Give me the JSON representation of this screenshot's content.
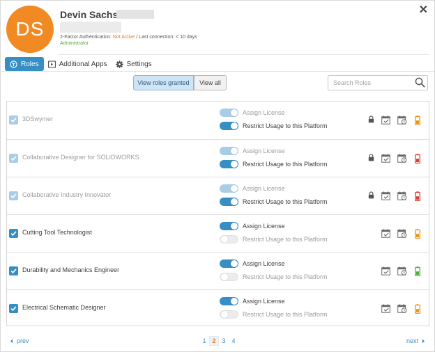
{
  "header": {
    "avatar_initials": "DS",
    "avatar_color": "#f28a24",
    "user_name": "Devin Sachs -",
    "auth_prefix": "2-Factor Authentication: ",
    "auth_status": "Not Active",
    "last_connection": " / Last connection: < 10 days",
    "user_role": "Administrator",
    "close_label": "✕"
  },
  "tabs": [
    {
      "label": "Roles",
      "icon": "roles-icon",
      "active": true
    },
    {
      "label": "Additional Apps",
      "icon": "apps-icon",
      "active": false
    },
    {
      "label": "Settings",
      "icon": "gear-icon",
      "active": false
    }
  ],
  "filters": {
    "view_granted": "View roles granted",
    "view_all": "View all"
  },
  "search": {
    "placeholder": "Search Roles",
    "value": ""
  },
  "toggle_labels": {
    "assign": "Assign License",
    "restrict": "Restrict Usage to this Platform"
  },
  "roles": [
    {
      "name": "3DSwymer",
      "checked": true,
      "locked": true,
      "assign_license": true,
      "restrict_usage": true,
      "license_status": "orange"
    },
    {
      "name": "Collaborative Designer for SOLIDWORKS",
      "checked": true,
      "locked": true,
      "assign_license": true,
      "restrict_usage": true,
      "license_status": "red"
    },
    {
      "name": "Collaborative Industry Innovator",
      "checked": true,
      "locked": true,
      "assign_license": true,
      "restrict_usage": true,
      "license_status": "red"
    },
    {
      "name": "Cutting Tool Technologist",
      "checked": true,
      "locked": false,
      "assign_license": true,
      "restrict_usage": false,
      "license_status": "orange"
    },
    {
      "name": "Durability and Mechanics Engineer",
      "checked": true,
      "locked": false,
      "assign_license": true,
      "restrict_usage": false,
      "license_status": "green"
    },
    {
      "name": "Electrical Schematic Designer",
      "checked": true,
      "locked": false,
      "assign_license": true,
      "restrict_usage": false,
      "license_status": "orange"
    }
  ],
  "pagination": {
    "prev": "prev",
    "next": "next",
    "pages": [
      "1",
      "2",
      "3",
      "4"
    ],
    "current": "2"
  },
  "colors": {
    "accent": "#368ec4",
    "status_orange": "#f29111",
    "status_red": "#e03c31",
    "status_green": "#4cae3a",
    "admin_green": "#57a832",
    "not_active": "#e87722"
  }
}
